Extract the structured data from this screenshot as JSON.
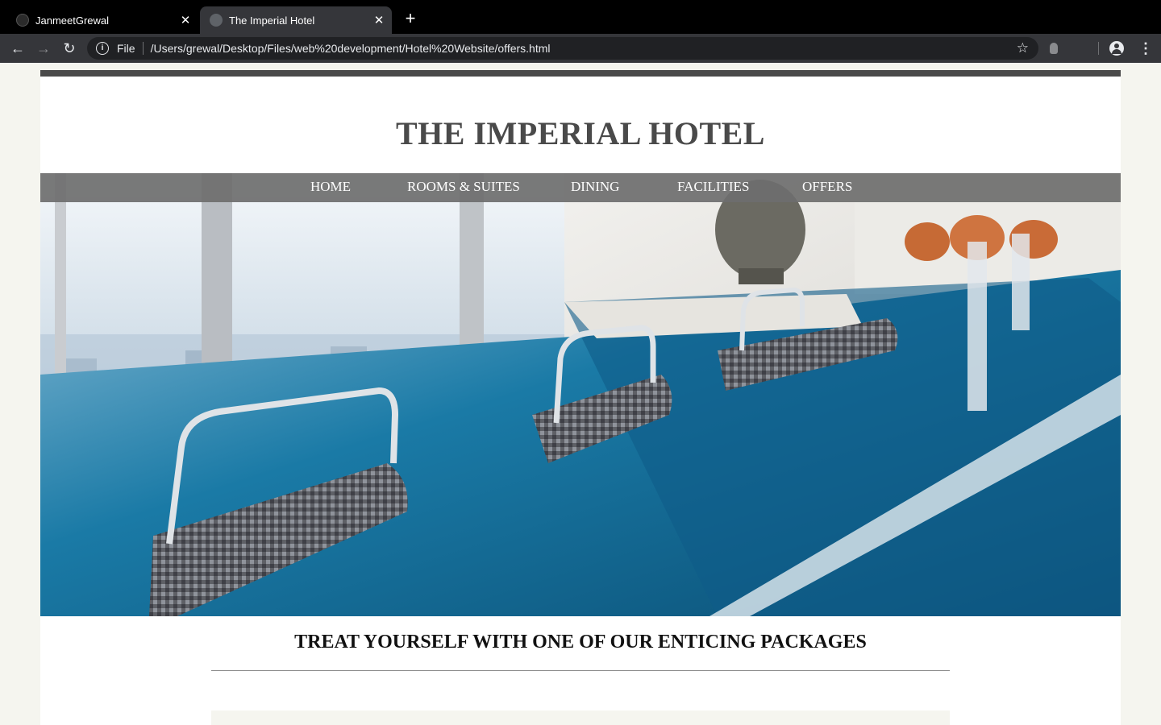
{
  "browser": {
    "tabs": [
      {
        "title": "JanmeetGrewal",
        "active": false
      },
      {
        "title": "The Imperial Hotel",
        "active": true
      }
    ],
    "new_tab_icon": "plus-icon",
    "address": {
      "scheme": "File",
      "url": "/Users/grewal/Desktop/Files/web%20development/Hotel%20Website/offers.html"
    }
  },
  "site": {
    "title": "THE IMPERIAL HOTEL",
    "nav": [
      "HOME",
      "ROOMS & SUITES",
      "DINING",
      "FACILITIES",
      "OFFERS"
    ],
    "hero_alt": "hotel-pool-photo",
    "tagline": "TREAT YOURSELF WITH ONE OF OUR ENTICING PACKAGES"
  },
  "colors": {
    "page_bg": "#f5f5ef",
    "title_text": "#4a4a4a",
    "nav_bg": "#6e6e6e",
    "pool_blue": "#0e5f86"
  }
}
